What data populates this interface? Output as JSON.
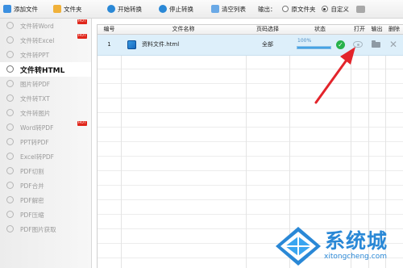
{
  "toolbar": {
    "add_file": "添加文件",
    "folder": "文件夹",
    "start": "开始转换",
    "stop": "停止转换",
    "clear": "清空列表",
    "output_label": "输出：",
    "output_option_original": "原文件夹",
    "output_option_custom": "自定义",
    "output_selected": "自定义"
  },
  "sidebar": {
    "items": [
      {
        "label": "文件转Word",
        "hot": true
      },
      {
        "label": "文件转Excel",
        "hot": true
      },
      {
        "label": "文件转PPT",
        "hot": false
      },
      {
        "label": "文件转HTML",
        "hot": false,
        "active": true
      },
      {
        "label": "图片转PDF",
        "hot": false
      },
      {
        "label": "文件转TXT",
        "hot": false
      },
      {
        "label": "文件转图片",
        "hot": false
      },
      {
        "label": "Word转PDF",
        "hot": true
      },
      {
        "label": "PPT转PDF",
        "hot": false
      },
      {
        "label": "Excel转PDF",
        "hot": false
      },
      {
        "label": "PDF切割",
        "hot": false
      },
      {
        "label": "PDF合并",
        "hot": false
      },
      {
        "label": "PDF解密",
        "hot": false
      },
      {
        "label": "PDF压缩",
        "hot": false
      },
      {
        "label": "PDF图片获取",
        "hot": false
      }
    ],
    "hot_badge": "HOT"
  },
  "table": {
    "columns": [
      "编号",
      "文件名称",
      "页码选择",
      "状态",
      "打开",
      "输出",
      "删除"
    ],
    "rows": [
      {
        "index": "1",
        "filename": "资料文件.html",
        "pages": "全部",
        "progress_text": "100%",
        "progress": 1.0
      }
    ]
  },
  "watermark": {
    "title": "系统城",
    "subtitle": "xitongcheng.com"
  },
  "colors": {
    "accent": "#2a88d6",
    "selected_row": "#ddeffa",
    "arrow": "#e3242b",
    "success": "#27b24a"
  }
}
